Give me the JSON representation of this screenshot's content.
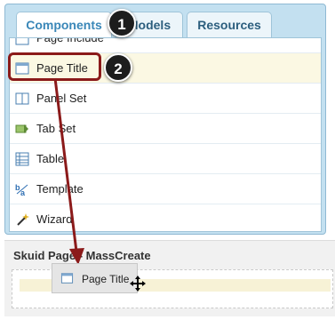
{
  "tabs": [
    {
      "label": "Components",
      "active": true
    },
    {
      "label": "Models",
      "active": false
    },
    {
      "label": "Resources",
      "active": false
    }
  ],
  "components": [
    {
      "label": "Page Include",
      "icon": "page-include-icon"
    },
    {
      "label": "Page Title",
      "icon": "page-title-icon"
    },
    {
      "label": "Panel Set",
      "icon": "panel-set-icon"
    },
    {
      "label": "Tab Set",
      "icon": "tab-set-icon"
    },
    {
      "label": "Table",
      "icon": "table-icon"
    },
    {
      "label": "Template",
      "icon": "template-icon"
    },
    {
      "label": "Wizard",
      "icon": "wizard-icon"
    }
  ],
  "dropzone": {
    "title": "Skuid Page - MassCreate"
  },
  "drag_ghost": {
    "label": "Page Title"
  },
  "callouts": {
    "one": "1",
    "two": "2"
  },
  "colors": {
    "tab_panel_bg": "#c3e0f0",
    "active_tab_text": "#3a87b8",
    "highlight_row": "#fbf8e3",
    "annotation_red": "#8b1a1a",
    "callout_bg": "#1d1d1d"
  }
}
